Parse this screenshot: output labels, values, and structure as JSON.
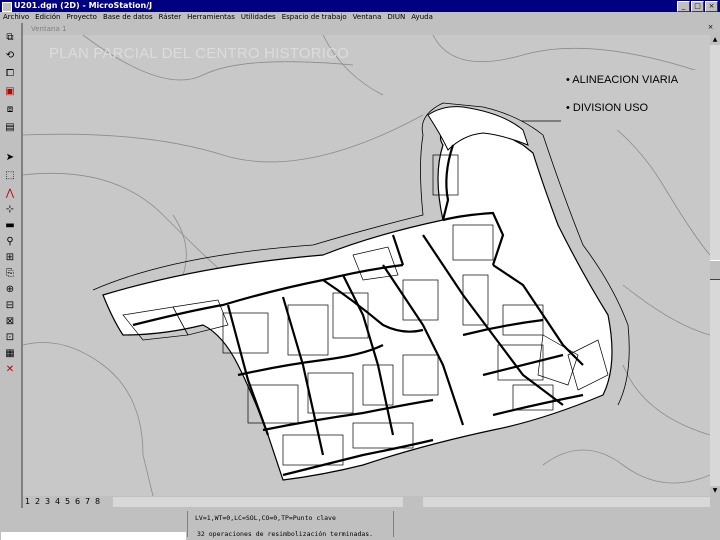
{
  "window": {
    "title": "U201.dgn (2D) - MicroStation/J",
    "controls": [
      "_",
      "□",
      "×"
    ]
  },
  "menu": [
    "Archivo",
    "Edición",
    "Proyecto",
    "Base de datos",
    "Ráster",
    "Herramientas",
    "Utilidades",
    "Espacio de trabajo",
    "Ventana",
    "DIUN",
    "Ayuda"
  ],
  "view": {
    "title": "Ventana 1",
    "plan_title": "PLAN PARCIAL DEL CENTRO HISTORICO",
    "legend": [
      "• ALINEACION VIARIA",
      "• DIVISION USO"
    ],
    "view_controls": [
      "1",
      "2",
      "3",
      "4",
      "5",
      "6",
      "7",
      "8"
    ]
  },
  "toolbox": {
    "icons": [
      "window-icon",
      "settings-icon",
      "copy-icon",
      "mark-icon",
      "hatch-icon",
      "grid-icon",
      "select-arrow-icon",
      "fence-icon",
      "arc-icon",
      "dimension-icon",
      "ruler-icon",
      "attributes-icon",
      "cell-icon",
      "text-icon",
      "zoom-icon",
      "measure-icon",
      "rotate-icon",
      "array-icon",
      "levels-icon",
      "delete-icon"
    ],
    "glyphs": [
      "⧉",
      "⟲",
      "⧠",
      "▣",
      "⧈",
      "▤",
      "➤",
      "⬚",
      "⋀",
      "⊹",
      "▬",
      "⚲",
      "⊞",
      "⎘",
      "⊕",
      "⊟",
      "⊠",
      "⊡",
      "▦",
      "✕"
    ]
  },
  "status": {
    "line1": "LV=1,WT=0,LC=SOL,CO=0,TP=Punto clave",
    "line2": "32 operaciones de resimbolización terminadas."
  }
}
